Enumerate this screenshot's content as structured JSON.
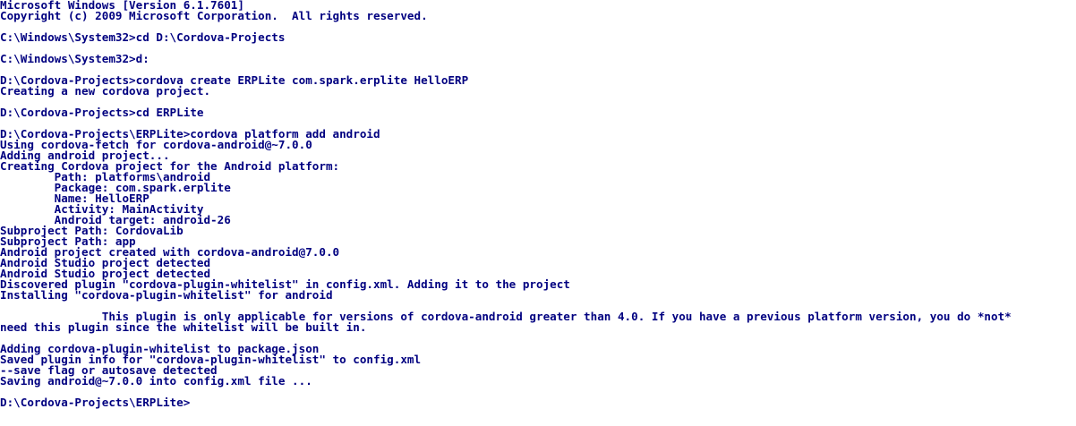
{
  "console": {
    "lines": [
      "Microsoft Windows [Version 6.1.7601]",
      "Copyright (c) 2009 Microsoft Corporation.  All rights reserved.",
      "",
      "C:\\Windows\\System32>cd D:\\Cordova-Projects",
      "",
      "C:\\Windows\\System32>d:",
      "",
      "D:\\Cordova-Projects>cordova create ERPLite com.spark.erplite HelloERP",
      "Creating a new cordova project.",
      "",
      "D:\\Cordova-Projects>cd ERPLite",
      "",
      "D:\\Cordova-Projects\\ERPLite>cordova platform add android",
      "Using cordova-fetch for cordova-android@~7.0.0",
      "Adding android project...",
      "Creating Cordova project for the Android platform:",
      "        Path: platforms\\android",
      "        Package: com.spark.erplite",
      "        Name: HelloERP",
      "        Activity: MainActivity",
      "        Android target: android-26",
      "Subproject Path: CordovaLib",
      "Subproject Path: app",
      "Android project created with cordova-android@7.0.0",
      "Android Studio project detected",
      "Android Studio project detected",
      "Discovered plugin \"cordova-plugin-whitelist\" in config.xml. Adding it to the project",
      "Installing \"cordova-plugin-whitelist\" for android",
      "",
      "               This plugin is only applicable for versions of cordova-android greater than 4.0. If you have a previous platform version, you do *not*",
      "need this plugin since the whitelist will be built in.",
      "",
      "Adding cordova-plugin-whitelist to package.json",
      "Saved plugin info for \"cordova-plugin-whitelist\" to config.xml",
      "--save flag or autosave detected",
      "Saving android@~7.0.0 into config.xml file ...",
      "",
      "D:\\Cordova-Projects\\ERPLite>"
    ]
  }
}
